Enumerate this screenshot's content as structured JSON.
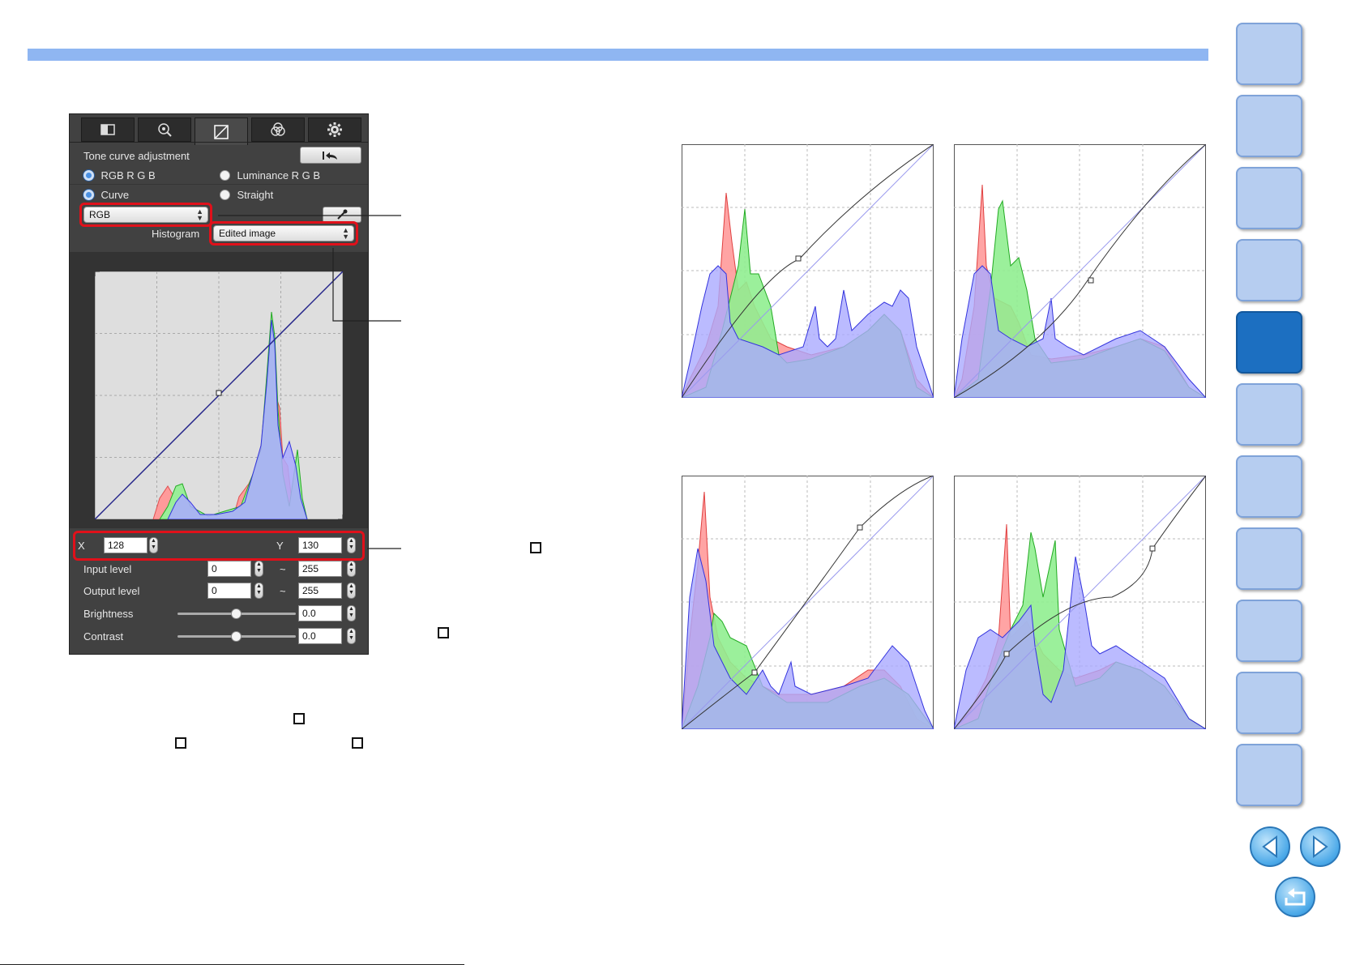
{
  "panel": {
    "title": "Tone curve adjustment",
    "mode_options": [
      "RGB R G B",
      "Luminance R G B"
    ],
    "mode_selected": "RGB R G B",
    "curve_options": [
      "Curve",
      "Straight"
    ],
    "curve_selected": "Curve",
    "channel_select": "RGB",
    "histogram_label": "Histogram",
    "histogram_select": "Edited image",
    "x_label": "X",
    "x_value": "128",
    "y_label": "Y",
    "y_value": "130",
    "input_level_label": "Input level",
    "input_level_min": "0",
    "input_level_max": "255",
    "output_level_label": "Output level",
    "output_level_min": "0",
    "output_level_max": "255",
    "tilde": "~",
    "brightness_label": "Brightness",
    "brightness_value": "0.0",
    "contrast_label": "Contrast",
    "contrast_value": "0.0",
    "tab_icons": [
      "basic-adjust-icon",
      "detail-zoom-icon",
      "tone-curve-icon",
      "color-icon",
      "settings-gear-icon"
    ],
    "active_tab_index": 2
  },
  "colors": {
    "header_bar": "#8fb6f2",
    "highlight": "#e0101a",
    "nav_tab": "#b6cdf0",
    "nav_tab_active": "#1c6fc1",
    "hist_red": "#ff8080",
    "hist_green": "#66e066",
    "hist_blue": "#8080ff"
  },
  "side_nav": {
    "tab_count": 11,
    "active_index": 4,
    "prev_icon": "left-arrow-icon",
    "next_icon": "right-arrow-icon",
    "return_icon": "return-icon"
  }
}
